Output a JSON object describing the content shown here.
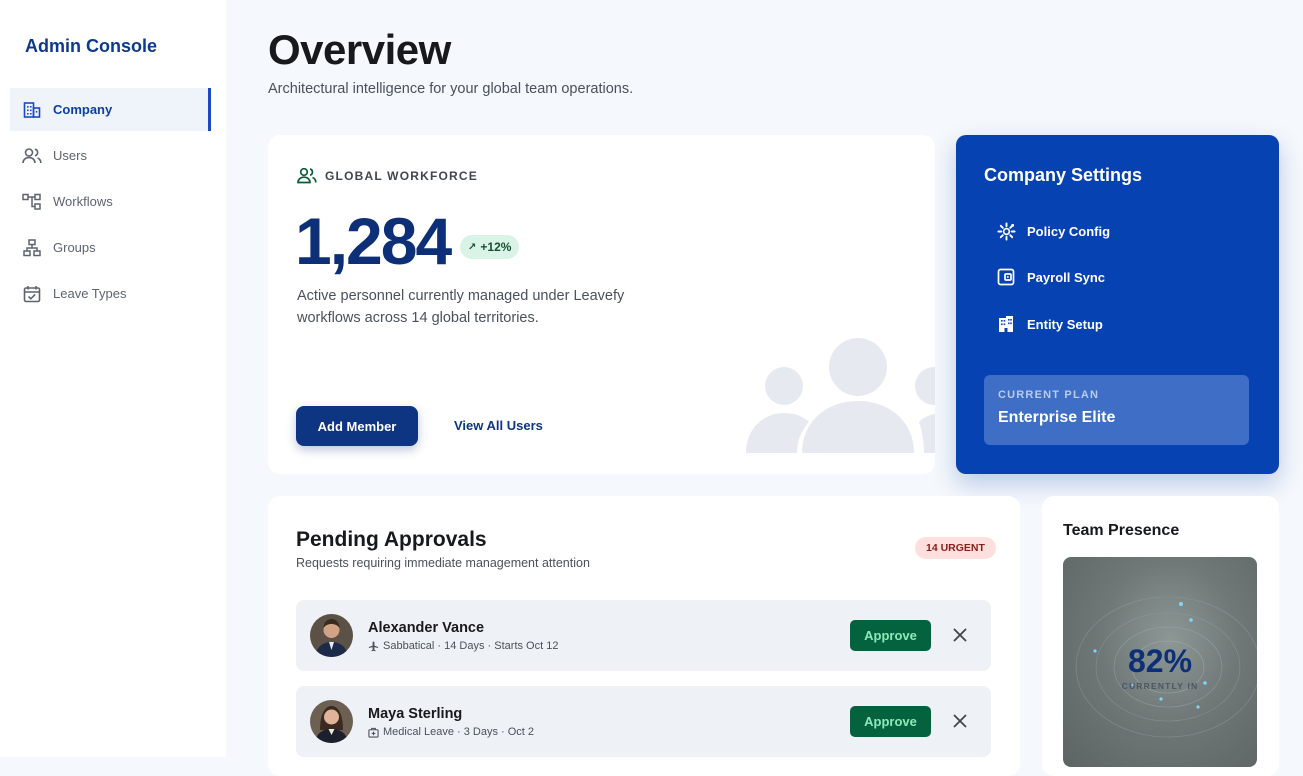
{
  "sidebar": {
    "brand": "Admin Console",
    "items": [
      {
        "label": "Company",
        "icon": "building-icon",
        "active": true
      },
      {
        "label": "Users",
        "icon": "users-icon"
      },
      {
        "label": "Workflows",
        "icon": "workflow-icon"
      },
      {
        "label": "Groups",
        "icon": "groups-icon"
      },
      {
        "label": "Leave Types",
        "icon": "calendar-check-icon"
      }
    ]
  },
  "header": {
    "title": "Overview",
    "subtitle": "Architectural intelligence for your global team operations."
  },
  "workforce": {
    "label": "GLOBAL WORKFORCE",
    "count": "1,284",
    "trend": "+12%",
    "description": "Active personnel currently managed under Leavefy workflows across 14 global territories.",
    "add_member_label": "Add Member",
    "view_all_label": "View All Users"
  },
  "settings": {
    "title": "Company Settings",
    "items": [
      {
        "label": "Policy Config",
        "icon": "gear-icon"
      },
      {
        "label": "Payroll Sync",
        "icon": "wallet-icon"
      },
      {
        "label": "Entity Setup",
        "icon": "building-icon"
      }
    ],
    "plan_label": "CURRENT PLAN",
    "plan_name": "Enterprise Elite"
  },
  "approvals": {
    "title": "Pending Approvals",
    "subtitle": "Requests requiring immediate management attention",
    "urgent_badge": "14 URGENT",
    "approve_label": "Approve",
    "rows": [
      {
        "name": "Alexander Vance",
        "meta": "Sabbatical · 14 Days · Starts Oct 12",
        "meta_icon": "plane-icon"
      },
      {
        "name": "Maya Sterling",
        "meta": "Medical Leave · 3 Days · Oct 2",
        "meta_icon": "medical-bag-icon"
      }
    ]
  },
  "presence": {
    "title": "Team Presence",
    "percent": "82%",
    "label": "CURRENTLY IN",
    "progress": 0.82
  },
  "colors": {
    "primary": "#0e3582",
    "settings_bg": "#0642b1",
    "approve_bg": "#04623e",
    "urgent_bg": "#fde0de"
  }
}
